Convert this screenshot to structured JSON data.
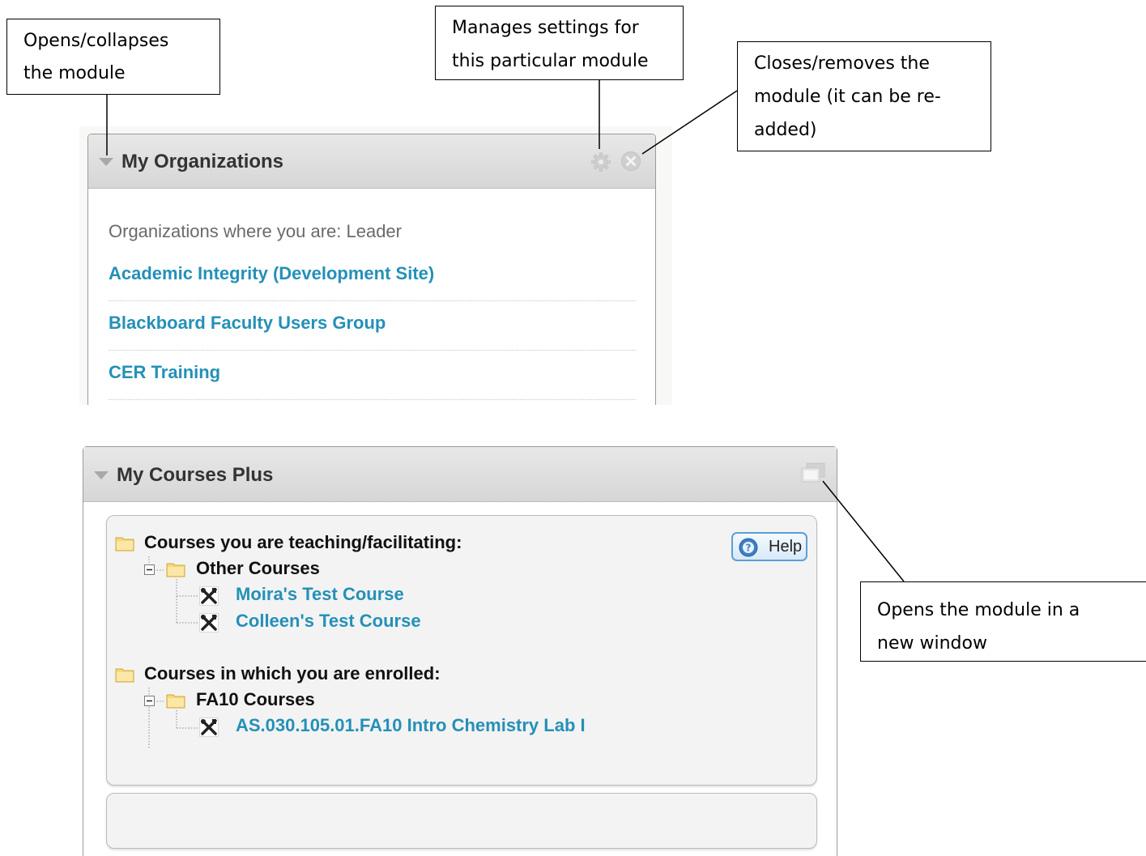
{
  "callouts": {
    "collapse": {
      "line1": "Opens/collapses",
      "line2": "the module"
    },
    "settings": {
      "line1": "Manages settings for",
      "line2": "this particular module"
    },
    "close": {
      "line1": "Closes/removes the",
      "line2": "module (it can be re-",
      "line3": "added)"
    },
    "new_window": {
      "line1": "Opens the module in a",
      "line2": "new window"
    }
  },
  "organizations_module": {
    "title": "My Organizations",
    "role_label": "Organizations where you are: Leader",
    "items": [
      {
        "label": "Academic Integrity (Development Site)"
      },
      {
        "label": "Blackboard Faculty Users Group"
      },
      {
        "label": "CER Training"
      }
    ],
    "icons": [
      "collapse-arrow-icon",
      "gear-icon",
      "close-icon"
    ]
  },
  "courses_module": {
    "title": "My Courses Plus",
    "help_label": "Help",
    "teaching": {
      "heading": "Courses you are teaching/facilitating:",
      "group": "Other Courses",
      "courses": [
        {
          "label": "Moira's Test Course"
        },
        {
          "label": "Colleen's Test Course"
        }
      ]
    },
    "enrolled": {
      "heading": "Courses in which you are enrolled:",
      "group": "FA10 Courses",
      "courses": [
        {
          "label": "AS.030.105.01.FA10 Intro Chemistry Lab I"
        }
      ]
    },
    "icons": [
      "collapse-arrow-icon",
      "new-window-icon",
      "folder-icon",
      "tools-icon",
      "help-icon"
    ]
  },
  "colors": {
    "link": "#2490b8",
    "header_bg": "#dcdcdc",
    "panel_bg": "#f3f3f3"
  }
}
